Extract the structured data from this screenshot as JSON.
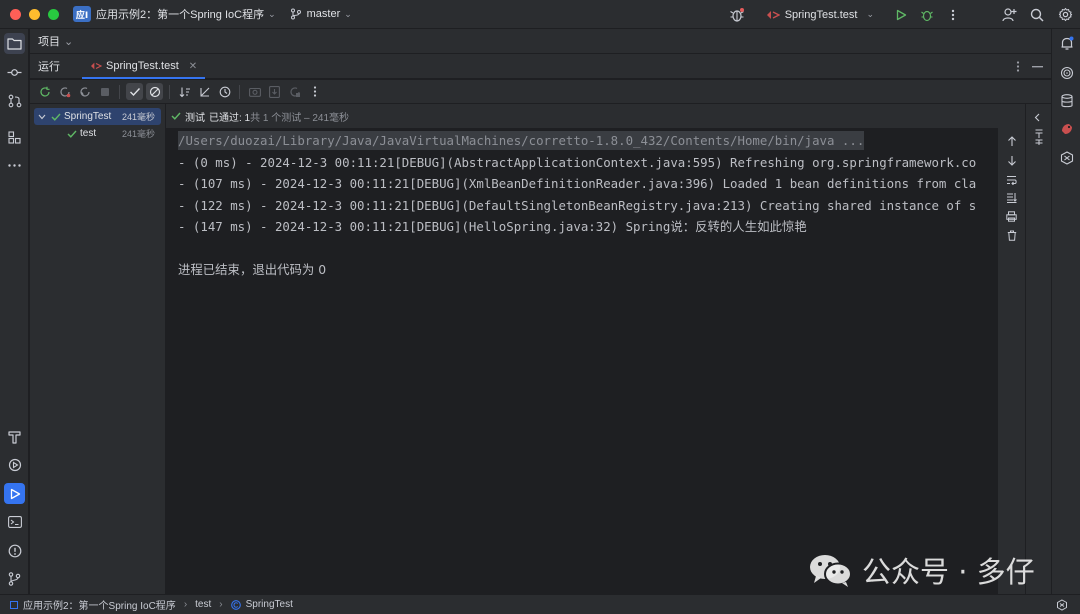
{
  "titlebar": {
    "project_badge": "应I",
    "project_name": "应用示例2：第一个Spring IoC程序",
    "branch": "master",
    "run_config": "SpringTest.test"
  },
  "project_bar": {
    "label": "项目"
  },
  "run_panel": {
    "title": "运行",
    "tab_label": "SpringTest.test",
    "status": {
      "prefix": "测试",
      "passed": "已通过: 1",
      "summary": "共 1 个测试 – 241毫秒"
    }
  },
  "test_tree": [
    {
      "name": "SpringTest",
      "duration": "241毫秒",
      "status": "passed"
    },
    {
      "name": "test",
      "duration": "241毫秒",
      "status": "passed"
    }
  ],
  "console": {
    "command": "/Users/duozai/Library/Java/JavaVirtualMachines/corretto-1.8.0_432/Contents/Home/bin/java ...",
    "lines": [
      "- (0 ms) - 2024-12-3 00:11:21[DEBUG](AbstractApplicationContext.java:595) Refreshing org.springframework.co",
      "- (107 ms) - 2024-12-3 00:11:21[DEBUG](XmlBeanDefinitionReader.java:396) Loaded 1 bean definitions from cla",
      "- (122 ms) - 2024-12-3 00:11:21[DEBUG](DefaultSingletonBeanRegistry.java:213) Creating shared instance of s",
      "- (147 ms) - 2024-12-3 00:11:21[DEBUG](HelloSpring.java:32) Spring说：反转的人生如此惊艳"
    ],
    "exit_line": "进程已结束，退出代码为 0"
  },
  "watermark": {
    "text": "公众号 · 多仔"
  },
  "statusbar": {
    "crumbs": [
      "应用示例2：第一个Spring IoC程序",
      "test",
      "SpringTest"
    ]
  },
  "colors": {
    "accent": "#3574f0",
    "pass": "#5fb865",
    "bg": "#1e1f22",
    "panel": "#2b2d30"
  }
}
